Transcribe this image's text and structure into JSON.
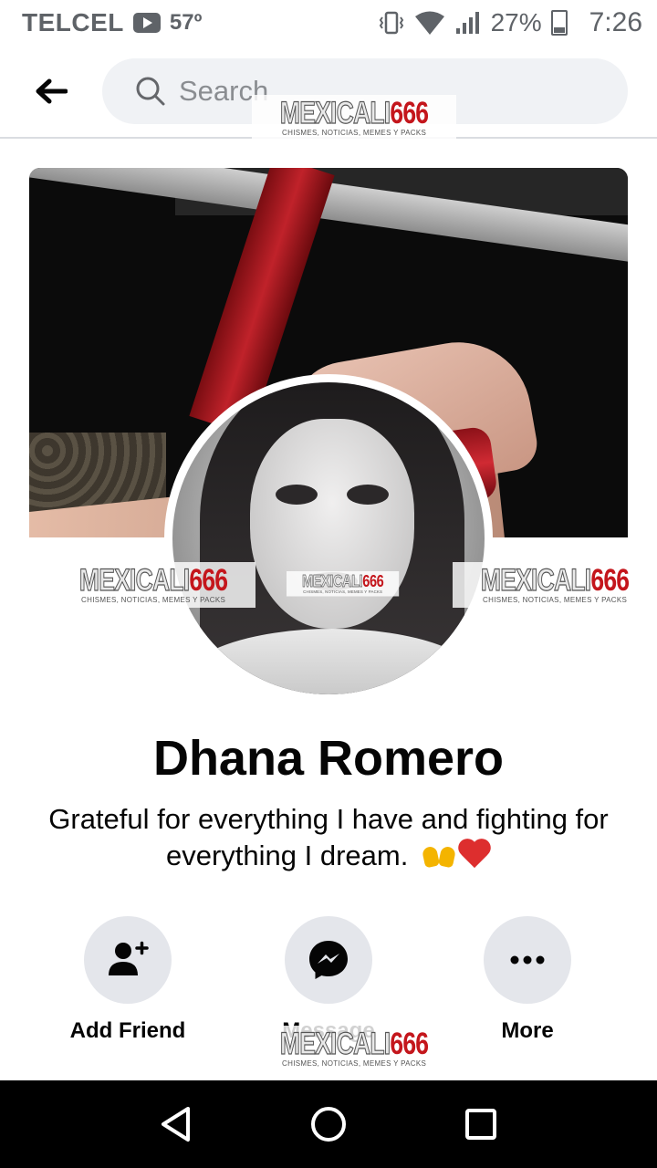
{
  "status_bar": {
    "carrier": "TELCEL",
    "temperature": "57º",
    "battery": "27%",
    "time": "7:26"
  },
  "search": {
    "placeholder": "Search"
  },
  "watermark": {
    "main_part1": "MEXICALI",
    "main_part2": "666",
    "subtitle": "CHISMES, NOTICIAS, MEMES Y PACKS"
  },
  "profile": {
    "name": "Dhana Romero",
    "bio": "Grateful for everything I have and fighting for everything I dream."
  },
  "actions": {
    "add_friend": "Add Friend",
    "message": "Message",
    "more": "More"
  },
  "colors": {
    "button_bg": "#e4e6eb",
    "search_bg": "#f0f2f5",
    "heart": "#dd2e2e",
    "watermark_red": "#c4161c"
  },
  "icons": {
    "back": "arrow-left-icon",
    "search": "search-icon",
    "add_friend": "add-person-icon",
    "message": "messenger-icon",
    "more": "ellipsis-icon",
    "nav_back": "triangle-back-icon",
    "nav_home": "circle-home-icon",
    "nav_recents": "square-recents-icon"
  }
}
